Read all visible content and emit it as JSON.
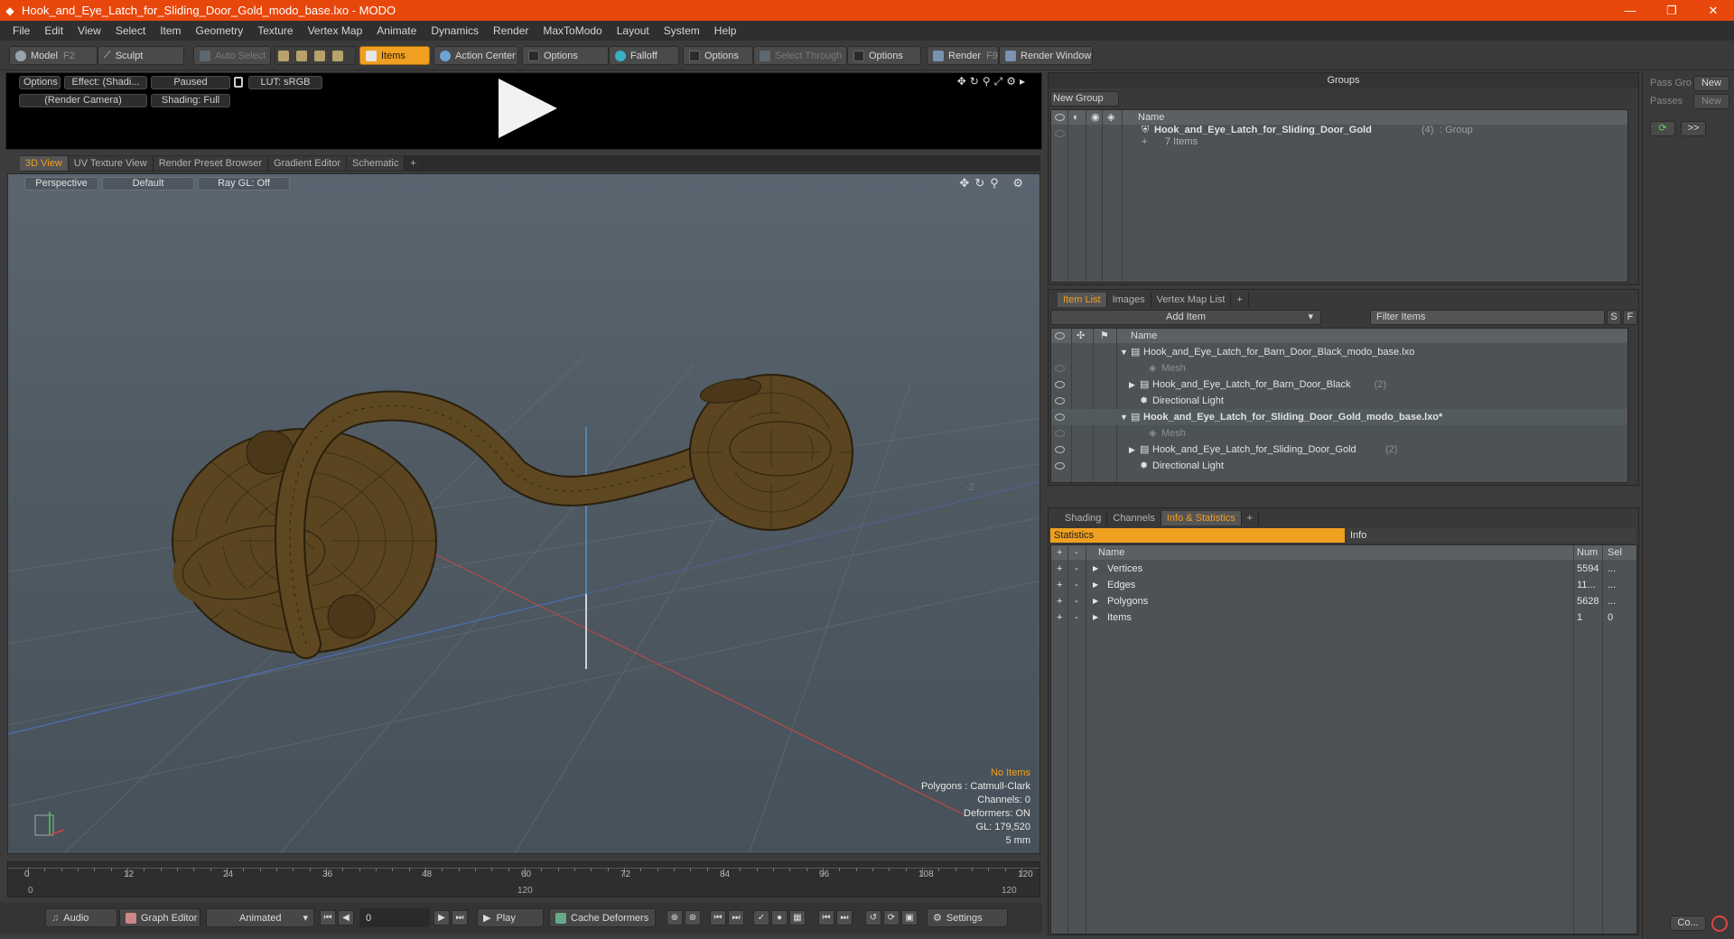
{
  "window": {
    "title": "Hook_and_Eye_Latch_for_Sliding_Door_Gold_modo_base.lxo - MODO",
    "minimize": "—",
    "maximize": "❐",
    "close": "✕"
  },
  "menu": [
    "File",
    "Edit",
    "View",
    "Select",
    "Item",
    "Geometry",
    "Texture",
    "Vertex Map",
    "Animate",
    "Dynamics",
    "Render",
    "MaxToModo",
    "Layout",
    "System",
    "Help"
  ],
  "toolbar": {
    "model": "Model",
    "model_key": "F2",
    "sculpt": "Sculpt",
    "auto_select": "Auto Select",
    "items": "Items",
    "action_center": "Action Center",
    "options1": "Options",
    "falloff": "Falloff",
    "options2": "Options",
    "select_through": "Select Through",
    "options3": "Options",
    "render": "Render",
    "render_key": "F9",
    "render_window": "Render Window"
  },
  "preview": {
    "options": "Options",
    "effect": "Effect: (Shadi...",
    "paused": "Paused",
    "lut": "LUT: sRGB",
    "camera": "(Render Camera)",
    "shading": "Shading: Full"
  },
  "viewport_tabs": [
    "3D View",
    "UV Texture View",
    "Render Preset Browser",
    "Gradient Editor",
    "Schematic"
  ],
  "viewport": {
    "perspective": "Perspective",
    "default": "Default",
    "raygl": "Ray GL: Off",
    "axis_label": "-Z",
    "info": {
      "no_items": "No Items",
      "polygons": "Polygons : Catmull-Clark",
      "channels": "Channels: 0",
      "deformers": "Deformers: ON",
      "gl": "GL: 179,520",
      "scale": "5 mm"
    }
  },
  "timeline": {
    "ticks": [
      "0",
      "12",
      "24",
      "36",
      "48",
      "60",
      "72",
      "84",
      "96",
      "108",
      "120"
    ],
    "range_labels": [
      "0",
      "120",
      "120"
    ]
  },
  "bottombar": {
    "audio": "Audio",
    "graph_editor": "Graph Editor",
    "animated": "Animated",
    "frame": "0",
    "play": "Play",
    "cache_deformers": "Cache Deformers",
    "settings": "Settings"
  },
  "groups": {
    "title": "Groups",
    "new_group": "New Group",
    "col_name": "Name",
    "item_name": "Hook_and_Eye_Latch_for_Sliding_Door_Gold",
    "item_count": "(4)",
    "item_type": ": Group",
    "item_sub": "7 Items"
  },
  "itemlist": {
    "tabs": [
      "Item List",
      "Images",
      "Vertex Map List"
    ],
    "add_item": "Add Item",
    "filter": "Filter Items",
    "s_btn": "S",
    "f_btn": "F",
    "col_name": "Name",
    "rows": [
      {
        "label": "Hook_and_Eye_Latch_for_Barn_Door_Black_modo_base.lxo",
        "indent": 0,
        "bold": false,
        "muted": false,
        "arrow": "▼",
        "count": ""
      },
      {
        "label": "Mesh",
        "indent": 2,
        "bold": false,
        "muted": true,
        "arrow": "",
        "count": ""
      },
      {
        "label": "Hook_and_Eye_Latch_for_Barn_Door_Black",
        "indent": 1,
        "bold": false,
        "muted": false,
        "arrow": "▶",
        "count": "(2)"
      },
      {
        "label": "Directional Light",
        "indent": 1,
        "bold": false,
        "muted": false,
        "arrow": "",
        "count": ""
      },
      {
        "label": "Hook_and_Eye_Latch_for_Sliding_Door_Gold_modo_base.lxo*",
        "indent": 0,
        "bold": true,
        "muted": false,
        "arrow": "▼",
        "count": ""
      },
      {
        "label": "Mesh",
        "indent": 2,
        "bold": false,
        "muted": true,
        "arrow": "",
        "count": ""
      },
      {
        "label": "Hook_and_Eye_Latch_for_Sliding_Door_Gold",
        "indent": 1,
        "bold": false,
        "muted": false,
        "arrow": "▶",
        "count": "(2)"
      },
      {
        "label": "Directional Light",
        "indent": 1,
        "bold": false,
        "muted": false,
        "arrow": "",
        "count": ""
      }
    ]
  },
  "stats": {
    "tabs": [
      "Shading",
      "Channels",
      "Info & Statistics"
    ],
    "statistics": "Statistics",
    "info": "Info",
    "col_name": "Name",
    "col_num": "Num",
    "col_sel": "Sel",
    "rows": [
      {
        "name": "Vertices",
        "num": "5594",
        "sel": "..."
      },
      {
        "name": "Edges",
        "num": "11...",
        "sel": "..."
      },
      {
        "name": "Polygons",
        "num": "5628",
        "sel": "..."
      },
      {
        "name": "Items",
        "num": "1",
        "sel": "0"
      }
    ]
  },
  "farright": {
    "pass_group": "Pass Gro",
    "passes": "Passes",
    "new1": "New",
    "new2": "New",
    "more": ">>",
    "co": "Co..."
  },
  "colors": {
    "accent": "#f0a020",
    "title_bar": "#e8470c",
    "model": "#5a4520"
  }
}
